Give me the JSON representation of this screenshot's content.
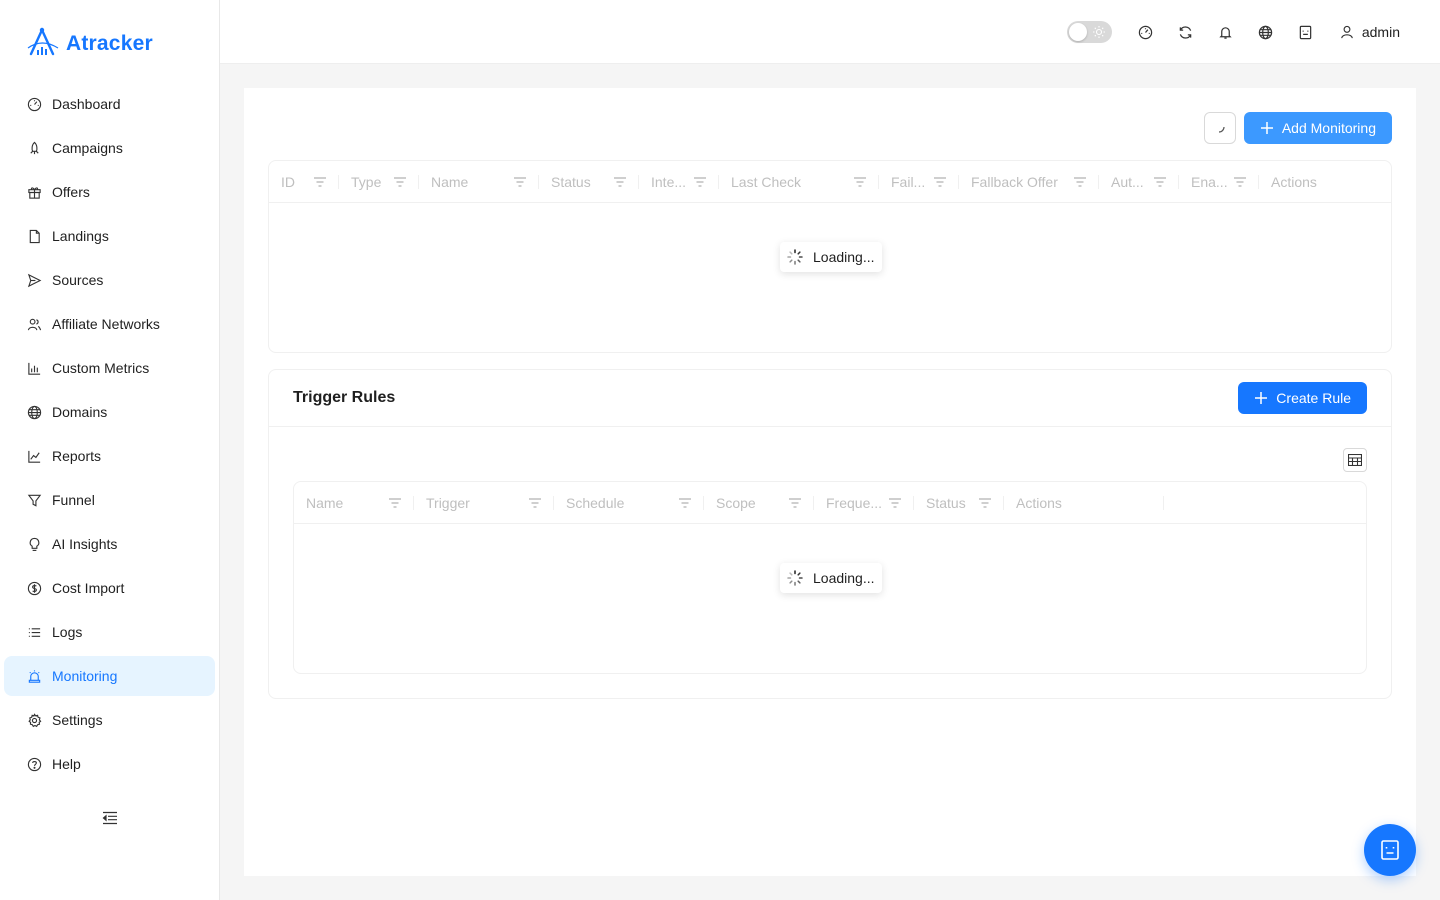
{
  "brand": {
    "name": "Atracker",
    "accent": "#1677ff"
  },
  "sidebar": {
    "items": [
      {
        "label": "Dashboard",
        "icon": "dashboard-icon"
      },
      {
        "label": "Campaigns",
        "icon": "rocket-icon"
      },
      {
        "label": "Offers",
        "icon": "gift-icon"
      },
      {
        "label": "Landings",
        "icon": "file-icon"
      },
      {
        "label": "Sources",
        "icon": "send-icon"
      },
      {
        "label": "Affiliate Networks",
        "icon": "users-icon"
      },
      {
        "label": "Custom Metrics",
        "icon": "bar-chart-icon"
      },
      {
        "label": "Domains",
        "icon": "globe-icon"
      },
      {
        "label": "Reports",
        "icon": "line-chart-icon"
      },
      {
        "label": "Funnel",
        "icon": "funnel-icon"
      },
      {
        "label": "AI Insights",
        "icon": "bulb-icon"
      },
      {
        "label": "Cost Import",
        "icon": "dollar-icon"
      },
      {
        "label": "Logs",
        "icon": "list-icon"
      },
      {
        "label": "Monitoring",
        "icon": "alert-icon",
        "active": true
      },
      {
        "label": "Settings",
        "icon": "gear-icon"
      },
      {
        "label": "Help",
        "icon": "question-icon"
      }
    ]
  },
  "header": {
    "user": "admin"
  },
  "monitoring": {
    "add_label": "Add Monitoring",
    "columns": [
      "ID",
      "Type",
      "Name",
      "Status",
      "Inte...",
      "Last Check",
      "Fail...",
      "Fallback Offer",
      "Aut...",
      "Ena...",
      "Actions"
    ],
    "loading_text": "Loading..."
  },
  "trigger_rules": {
    "title": "Trigger Rules",
    "create_label": "Create Rule",
    "columns": [
      "Name",
      "Trigger",
      "Schedule",
      "Scope",
      "Freque...",
      "Status",
      "Actions"
    ],
    "loading_text": "Loading..."
  }
}
